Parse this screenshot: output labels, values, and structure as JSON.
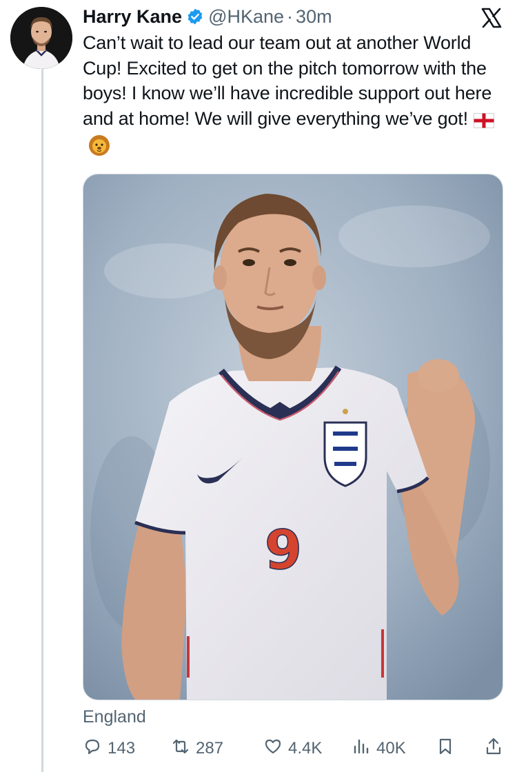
{
  "author": {
    "name": "Harry Kane",
    "handle": "@HKane",
    "separator": "·",
    "time": "30m",
    "verified": true
  },
  "tweet": {
    "text": "Can’t wait to lead our team out at another World Cup! Excited to get on the pitch tomorrow with the boys! I know we’ll have incredible support out here and at home! We will give everything we’ve got!",
    "emojis": [
      "england-flag-emoji",
      "lion-face-emoji"
    ],
    "location": "England"
  },
  "media": {
    "shirt_number": "9"
  },
  "metrics": {
    "replies": "143",
    "reposts": "287",
    "likes": "4.4K",
    "views": "40K"
  },
  "colors": {
    "text": "#0f1419",
    "secondary": "#536471",
    "verified": "#1d9bf0",
    "thread_line": "#cfd9de"
  },
  "icons": {
    "platform": "x-logo-icon",
    "reply": "speech-bubble-icon",
    "repost": "repost-arrows-icon",
    "like": "heart-icon",
    "views": "bar-chart-icon",
    "bookmark": "bookmark-icon",
    "share": "share-upload-icon"
  }
}
